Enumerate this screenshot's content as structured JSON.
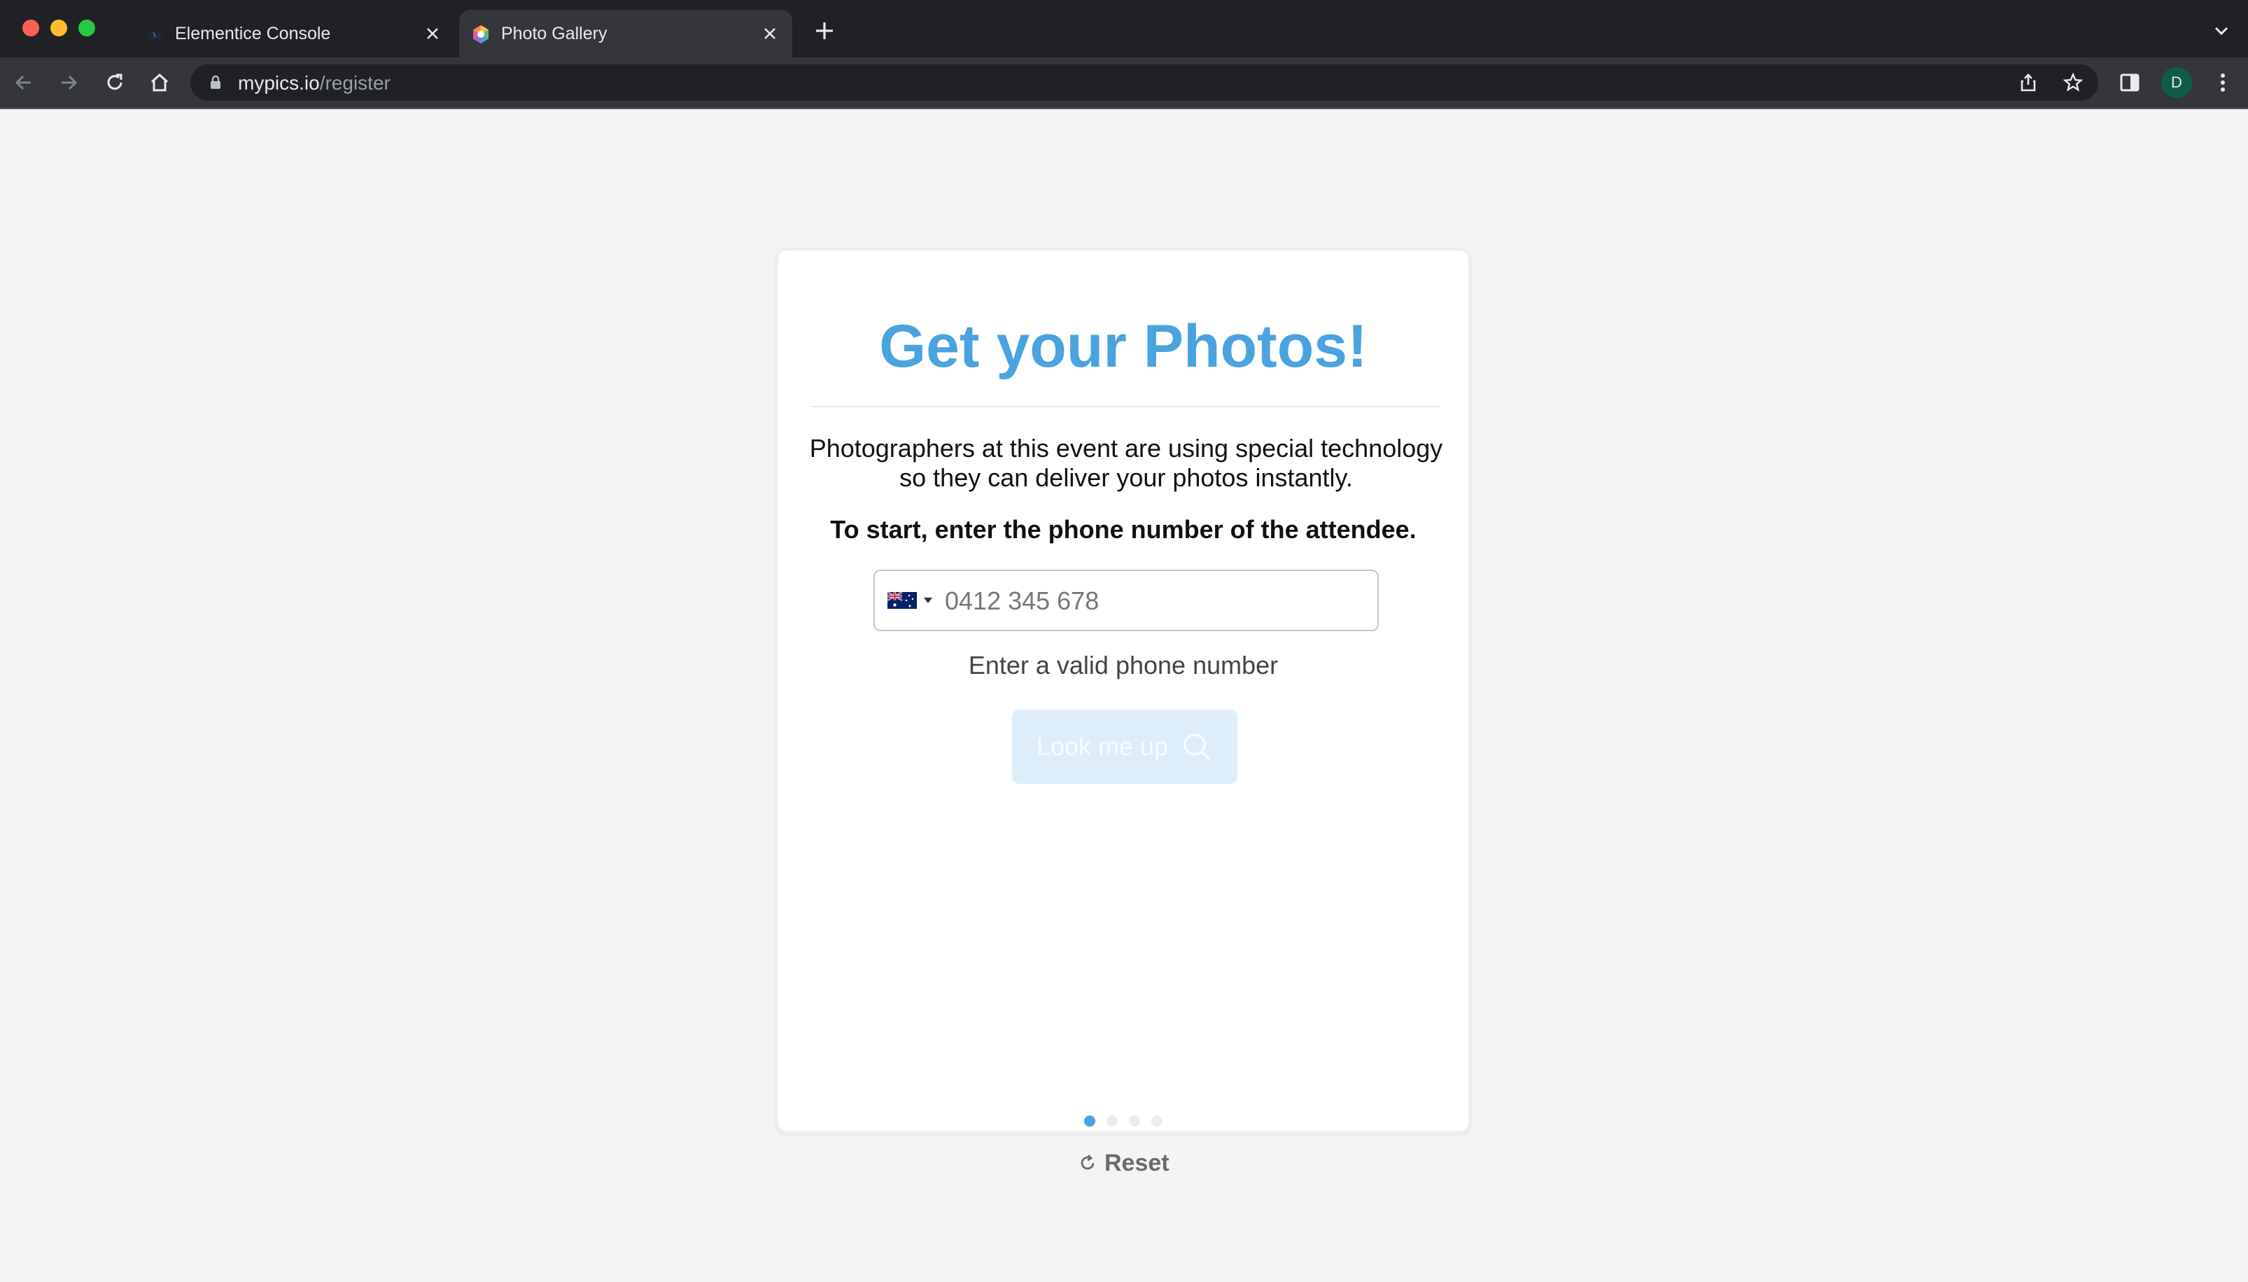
{
  "browser": {
    "tabs": [
      {
        "title": "Elementice Console",
        "active": false
      },
      {
        "title": "Photo Gallery",
        "active": true
      }
    ],
    "url": {
      "host": "mypics.io",
      "path": "/register"
    },
    "profile_initial": "D"
  },
  "page": {
    "title": "Get your Photos!",
    "description": "Photographers at this event are using special technology so they can deliver your photos instantly.",
    "instruction": "To start, enter the phone number of the attendee.",
    "phone": {
      "country": "Australia",
      "placeholder": "0412 345 678",
      "value": ""
    },
    "hint": "Enter a valid phone number",
    "lookup_label": "Look me up",
    "steps": {
      "count": 4,
      "current": 1
    },
    "reset_label": "Reset"
  },
  "colors": {
    "accent": "#4aa3df",
    "button_disabled_bg": "#ddeefa",
    "chrome_dark": "#202124",
    "chrome_toolbar": "#35363a"
  }
}
